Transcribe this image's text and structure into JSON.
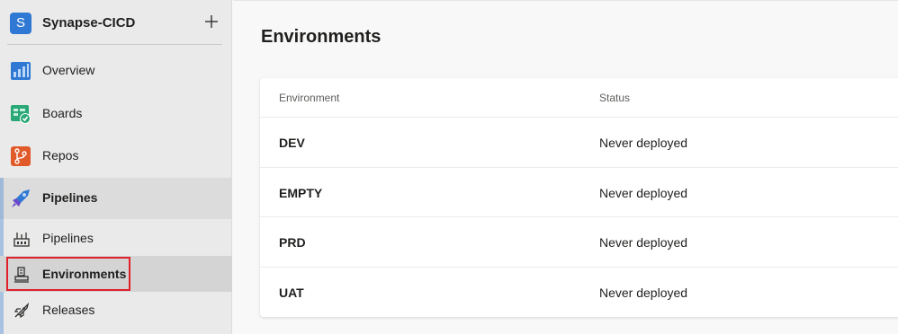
{
  "project": {
    "initial": "S",
    "name": "Synapse-CICD",
    "add_icon": "plus-icon"
  },
  "nav": {
    "overview": {
      "label": "Overview",
      "icon": "overview-icon"
    },
    "boards": {
      "label": "Boards",
      "icon": "boards-icon"
    },
    "repos": {
      "label": "Repos",
      "icon": "repos-icon"
    },
    "pipelines": {
      "label": "Pipelines",
      "icon": "pipelines-icon"
    }
  },
  "sub_nav": {
    "pipelines": {
      "label": "Pipelines",
      "icon": "pipelines-sub-icon"
    },
    "environments": {
      "label": "Environments",
      "icon": "environments-icon"
    },
    "releases": {
      "label": "Releases",
      "icon": "releases-icon"
    }
  },
  "page": {
    "title": "Environments"
  },
  "table": {
    "columns": [
      "Environment",
      "Status"
    ],
    "rows": [
      {
        "environment": "DEV",
        "status": "Never deployed"
      },
      {
        "environment": "EMPTY",
        "status": "Never deployed"
      },
      {
        "environment": "PRD",
        "status": "Never deployed"
      },
      {
        "environment": "UAT",
        "status": "Never deployed"
      }
    ]
  },
  "colors": {
    "accent": "#2f78d4",
    "highlight": "#e0202a",
    "repos": "#e05a2a",
    "boards": "#2aa876"
  }
}
